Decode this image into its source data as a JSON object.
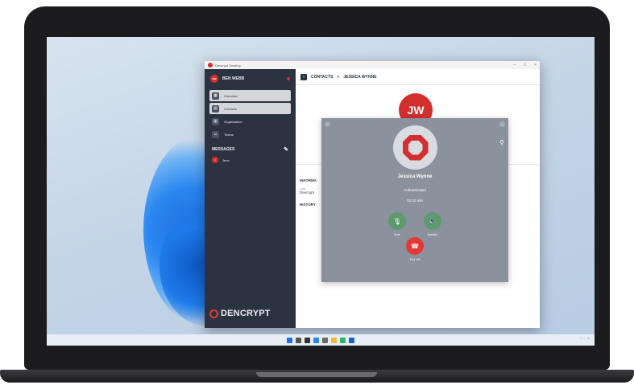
{
  "window": {
    "title": "Dencrypt Desktop"
  },
  "sidebar": {
    "user": {
      "initials": "BW",
      "name": "BEN WEBB"
    },
    "items": [
      {
        "label": "Overview"
      },
      {
        "label": "Contacts"
      },
      {
        "label": "Organisation"
      },
      {
        "label": "Teams"
      }
    ],
    "messages_header": "MESSAGES",
    "messages": [
      {
        "initials": "J",
        "label": "Jens"
      }
    ],
    "brand": "DENCRYPT"
  },
  "main": {
    "breadcrumb": {
      "root": "CONTACTS",
      "separator": ">",
      "current": "JESSICA WYNNE"
    },
    "avatar_initials": "JW",
    "info_header": "INFORMA",
    "info_label": "Intake",
    "info_value": "Dencrypt",
    "history_header": "HISTORY"
  },
  "call": {
    "name": "Jessica Wynne",
    "status": "Authenticated",
    "duration": "01:02 min",
    "mute_label": "Mute",
    "speaker_label": "Speaker",
    "end_label": "End call"
  },
  "colors": {
    "accent": "#d32f2f",
    "sidebar": "#2c3340",
    "call_panel": "#8b929d",
    "call_green": "#5f9a6e"
  },
  "icons": [
    "search-icon",
    "file-explorer-icon",
    "edge-icon",
    "store-icon",
    "start-icon"
  ]
}
